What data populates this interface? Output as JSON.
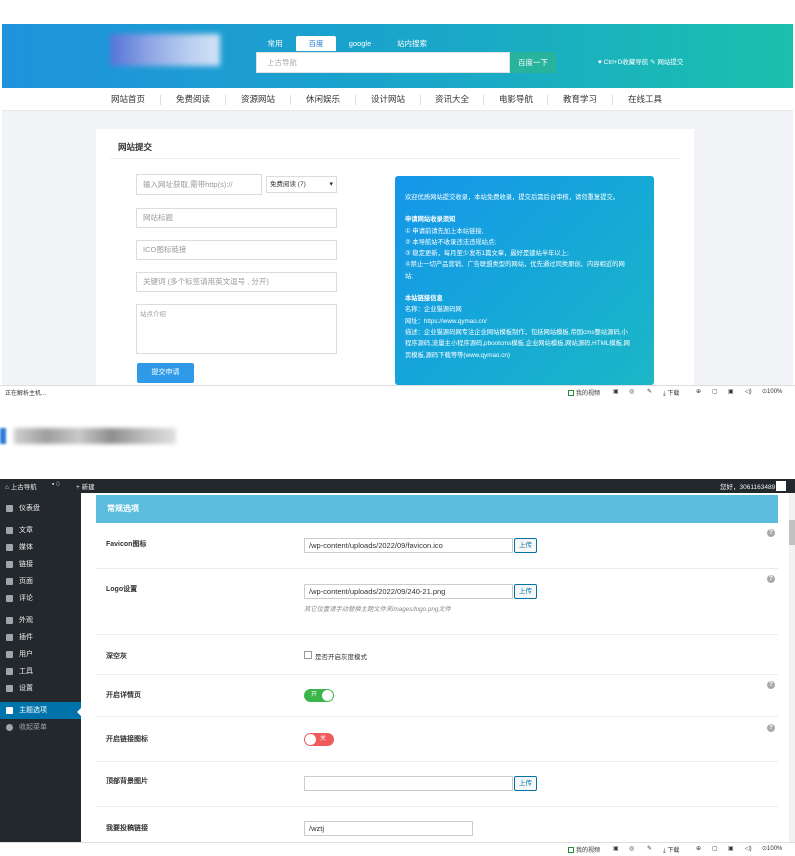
{
  "site": {
    "search_tabs": [
      "常用",
      "百度",
      "google",
      "站内搜索"
    ],
    "search_placeholder": "上古导航",
    "search_button": "百度一下",
    "header_links": "♥ Ctrl+D收藏导航  ✎ 网站提交",
    "nav": [
      "网站首页",
      "免费阅读",
      "资源网站",
      "休闲娱乐",
      "设计网站",
      "资讯大全",
      "电影导航",
      "教育学习",
      "在线工具"
    ]
  },
  "submit_form": {
    "title": "网站提交",
    "url_placeholder": "输入网址获取,需带http(s)://",
    "category_selected": "免费阅读 (7)",
    "title_placeholder": "网站标题",
    "icon_placeholder": "ICO图标链接",
    "keywords_placeholder": "关键词 (多个标签请用英文逗号 , 分开)",
    "desc_placeholder": "站点介绍",
    "submit_button": "提交申请",
    "info": {
      "intro": "欢迎优质网站提交收录，本站免费收录，提交后需后台审核，请勿重复提交。",
      "rules_title": "申请网站收录须知",
      "rules": [
        "① 申请前请先加上本站链接;",
        "② 本导航站不收录违法违规站点;",
        "③ 稳定更新，每月至少发布1篇文章，最好是建站半年以上;",
        "④禁止一切产品营销、广告联盟类型的网站，优先通过同类原创、内容相近的网",
        "站;"
      ],
      "link_title": "本站链接信息",
      "link_info": [
        "名称：企业猫源码网",
        "网址：https://www.qymao.cn/",
        "描述：企业猫源码网专注企业网站模板制作，包括网站模板,帝国cms整站源码,小",
        "程序源码,流量主小程序源码,pbootcms模板,企业网站模板,网站源码,HTML模板,网",
        "页模板,源码下载等等(www.qymao.cn)"
      ]
    }
  },
  "statusbar": {
    "left_text": "正在解析主机...",
    "right_items": [
      "我的视频",
      "下载",
      "100%"
    ]
  },
  "wp": {
    "adminbar": {
      "site_name": "上古导航",
      "comments": "0",
      "new": "+ 新建",
      "greeting": "您好，3061163489"
    },
    "sidebar": [
      "仪表盘",
      "文章",
      "媒体",
      "链接",
      "页面",
      "评论",
      "外观",
      "插件",
      "用户",
      "工具",
      "设置",
      "主题选项",
      "收起菜单"
    ],
    "section_title": "常规选项",
    "rows": {
      "favicon_label": "Favicon图标",
      "favicon_value": "/wp-content/uploads/2022/09/favicon.ico",
      "logo_label": "Logo设置",
      "logo_value": "/wp-content/uploads/2022/09/240-21.png",
      "logo_hint": "其它位置请手动替换主题文件夹images/logo.png文件",
      "gray_label": "深空灰",
      "gray_checkbox": "是否开启灰度模式",
      "detail_label": "开启详情页",
      "detail_toggle": "开",
      "detail_on": true,
      "linkicon_label": "开启链接图标",
      "linkicon_toggle": "关",
      "linkicon_on": false,
      "topbg_label": "顶部背景图片",
      "topbg_value": "",
      "submit_label": "我要投稿链接",
      "submit_value": "/wztj",
      "upload_label": "上传",
      "help": "?"
    }
  },
  "colors": {
    "header_start": "#1f92dc",
    "header_end": "#1bc0ad",
    "wp_dark": "#23282d",
    "wp_active": "#0073aa",
    "section_head": "#5bbcde",
    "toggle_on": "#3bb54a",
    "toggle_off": "#f05a5a"
  }
}
